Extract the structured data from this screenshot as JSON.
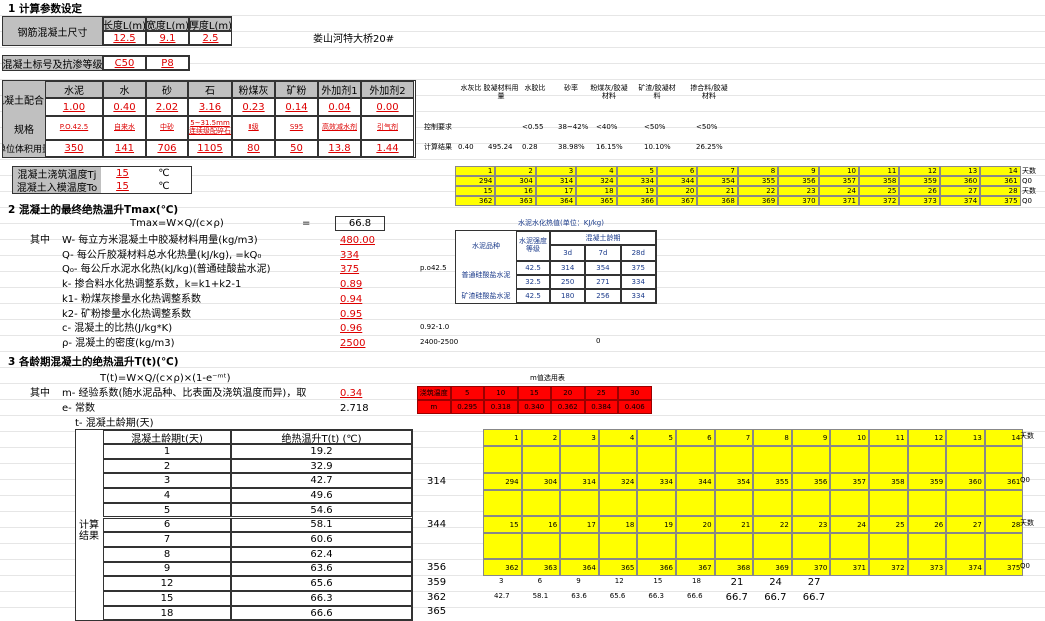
{
  "s1": {
    "title": "1  计算参数设定",
    "size_label": "钢筋混凝土尺寸",
    "size_headers": [
      "长度L(m)",
      "宽度L(m)",
      "厚度L(m)"
    ],
    "size_values": [
      "12.5",
      "9.1",
      "2.5"
    ],
    "project": "娄山河特大桥20#",
    "grade_label": "混凝土标号及抗渗等级",
    "grade": "C50",
    "anti": "P8",
    "mix_label": "混凝土配合比",
    "mix_headers": [
      "水泥",
      "水",
      "砂",
      "石",
      "粉煤灰",
      "矿粉",
      "外加剂1",
      "外加剂2"
    ],
    "mix_values": [
      "1.00",
      "0.40",
      "2.02",
      "3.16",
      "0.23",
      "0.14",
      "0.04",
      "0.00"
    ],
    "spec_label": "规格",
    "spec_values": [
      "P.O.42.5",
      "自来水",
      "中砂",
      "5~31.5mm连续级配碎石",
      "Ⅱ级",
      "S95",
      "高效减水剂",
      "引气剂"
    ],
    "unit_label": "单位体积用量",
    "unit_values": [
      "350",
      "141",
      "706",
      "1105",
      "80",
      "50",
      "13.8",
      "1.44"
    ],
    "pour_label": "混凝土浇筑温度Tj",
    "pour_val": "15",
    "pour_unit": "℃",
    "in_label": "混凝土入模温度To",
    "in_val": "15",
    "in_unit": "℃"
  },
  "ratio": {
    "headers": [
      "水灰比",
      "胶凝材料用量",
      "水胶比",
      "砂率",
      "粉煤灰/胶凝材料",
      "矿渣/胶凝材料",
      "掺合料/胶凝材料"
    ],
    "req_label": "控制要求",
    "req": [
      "",
      "",
      "<0.55",
      "38~42%",
      "<40%",
      "<50%",
      "<50%"
    ],
    "res_label": "计算结果",
    "res": [
      "0.40",
      "495.24",
      "0.28",
      "38.98%",
      "16.15%",
      "10.10%",
      "26.25%"
    ]
  },
  "ytab1": {
    "r1": [
      "1",
      "2",
      "3",
      "4",
      "5",
      "6",
      "7",
      "8",
      "9",
      "10",
      "11",
      "12",
      "13",
      "14"
    ],
    "r2": [
      "294",
      "304",
      "314",
      "324",
      "334",
      "344",
      "354",
      "355",
      "356",
      "357",
      "358",
      "359",
      "360",
      "361"
    ],
    "r3": [
      "15",
      "16",
      "17",
      "18",
      "19",
      "20",
      "21",
      "22",
      "23",
      "24",
      "25",
      "26",
      "27",
      "28"
    ],
    "r4": [
      "362",
      "363",
      "364",
      "365",
      "366",
      "367",
      "368",
      "369",
      "370",
      "371",
      "372",
      "373",
      "374",
      "375"
    ],
    "side": [
      "天数",
      "Q0",
      "天数",
      "Q0"
    ]
  },
  "s2": {
    "title": "2  混凝土的最终绝热温升Tmax(℃)",
    "formula": "Tmax=W×Q/(c×ρ)",
    "eq": "=",
    "result": "66.8",
    "qizhong": "其中",
    "rows": [
      {
        "l": "W- 每立方米混凝土中胶凝材料用量(kg/m3)",
        "v": "480.00",
        "n": ""
      },
      {
        "l": "Q- 每公斤胶凝材料总水化热量(kJ/kg), =kQ₀",
        "v": "334",
        "n": ""
      },
      {
        "l": "Q₀- 每公斤水泥水化热(kJ/kg)(普通硅酸盐水泥)",
        "v": "375",
        "n": "p.o42.5"
      },
      {
        "l": "k- 掺合料水化热调整系数，k=k1+k2-1",
        "v": "0.89",
        "n": ""
      },
      {
        "l": "k1- 粉煤灰掺量水化热调整系数",
        "v": "0.94",
        "n": ""
      },
      {
        "l": "k2- 矿粉掺量水化热调整系数",
        "v": "0.95",
        "n": ""
      },
      {
        "l": "c- 混凝土的比热(J/kg*K)",
        "v": "0.96",
        "n": "0.92-1.0"
      },
      {
        "l": "ρ- 混凝土的密度(kg/m3)",
        "v": "2500",
        "n": "2400-2500"
      }
    ],
    "zero": "0"
  },
  "heat": {
    "title": "水泥水化热值(单位：KJ/kg)",
    "h1": "水泥品种",
    "h2": "水泥强度等级",
    "h3": "混凝土龄期",
    "days": [
      "3d",
      "7d",
      "28d"
    ],
    "pt": "普通硅酸盐水泥",
    "kz": "矿渣硅酸盐水泥",
    "rows": [
      [
        "42.5",
        "314",
        "354",
        "375"
      ],
      [
        "32.5",
        "250",
        "271",
        "334"
      ],
      [
        "42.5",
        "180",
        "256",
        "334"
      ]
    ]
  },
  "s3": {
    "title": "3  各龄期混凝土的绝热温升T(t)(℃)",
    "formula": "T(t)=W×Q/(c×ρ)×(1-e⁻ᵐᵗ)",
    "qizhong": "其中",
    "m_label": "m- 经验系数(随水泥品种、比表面及浇筑温度而异)，取",
    "m_val": "0.34",
    "e_label": "e- 常数",
    "e_val": "2.718",
    "t_label": "t- 混凝土龄期(天)",
    "tbl_h": [
      "混凝土龄期t(天)",
      "绝热温升T(t) (℃)"
    ],
    "tbl_side": "计算结果",
    "tbl": [
      [
        "1",
        "19.2"
      ],
      [
        "2",
        "32.9"
      ],
      [
        "3",
        "42.7"
      ],
      [
        "4",
        "49.6"
      ],
      [
        "5",
        "54.6"
      ],
      [
        "6",
        "58.1"
      ],
      [
        "7",
        "60.6"
      ],
      [
        "8",
        "62.4"
      ],
      [
        "9",
        "63.6"
      ],
      [
        "12",
        "65.6"
      ],
      [
        "15",
        "66.3"
      ],
      [
        "18",
        "66.6"
      ]
    ]
  },
  "mref": {
    "title": "m值选用表",
    "h": [
      "浇筑温度",
      "5",
      "10",
      "15",
      "20",
      "25",
      "30"
    ],
    "v": [
      "m",
      "0.295",
      "0.318",
      "0.340",
      "0.362",
      "0.384",
      "0.406"
    ]
  },
  "ytab2": {
    "r1": [
      "1",
      "2",
      "3",
      "4",
      "5",
      "6",
      "7",
      "8",
      "9",
      "10",
      "11",
      "12",
      "13",
      "14"
    ],
    "r2": [
      "294",
      "304",
      "314",
      "324",
      "334",
      "344",
      "354",
      "355",
      "356",
      "357",
      "358",
      "359",
      "360",
      "361"
    ],
    "r3": [
      "15",
      "16",
      "17",
      "18",
      "19",
      "20",
      "21",
      "22",
      "23",
      "24",
      "25",
      "26",
      "27",
      "28"
    ],
    "r4": [
      "362",
      "363",
      "364",
      "365",
      "366",
      "367",
      "368",
      "369",
      "370",
      "371",
      "372",
      "373",
      "374",
      "375"
    ],
    "side": [
      "天数",
      "Q0",
      "天数",
      "Q0"
    ],
    "left": [
      "314",
      "344",
      "356",
      "359",
      "362",
      "365"
    ],
    "bot1": [
      "3",
      "6",
      "9",
      "12",
      "15",
      "18",
      "21",
      "24",
      "27"
    ],
    "bot2": [
      "42.7",
      "58.1",
      "63.6",
      "65.6",
      "66.3",
      "66.6",
      "66.7",
      "66.7",
      "66.7"
    ]
  }
}
